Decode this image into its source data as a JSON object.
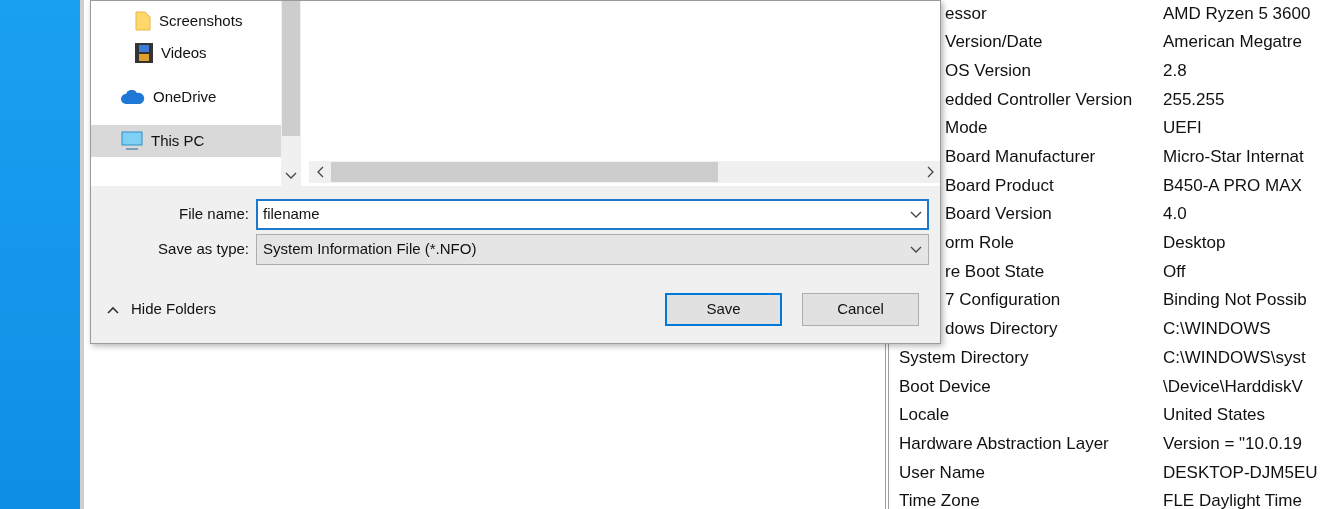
{
  "dialog": {
    "nav_items": [
      {
        "label": "Screenshots",
        "kind": "folder",
        "selected": false
      },
      {
        "label": "Videos",
        "kind": "videos",
        "selected": false
      },
      {
        "label": "OneDrive",
        "kind": "cloud",
        "selected": false
      },
      {
        "label": "This PC",
        "kind": "pc",
        "selected": true
      }
    ],
    "file_name": {
      "label": "File name:",
      "value": "filename"
    },
    "save_as_type": {
      "label": "Save as type:",
      "value": "System Information File (*.NFO)"
    },
    "hide_folders": "Hide Folders",
    "buttons": [
      {
        "label": "Save",
        "default": true
      },
      {
        "label": "Cancel",
        "default": false
      }
    ]
  },
  "summary": [
    {
      "item": "essor",
      "value": "AMD Ryzen 5 3600"
    },
    {
      "item": "Version/Date",
      "value": "American Megatre"
    },
    {
      "item": "OS Version",
      "value": "2.8"
    },
    {
      "item": "edded Controller Version",
      "value": "255.255"
    },
    {
      "item": "Mode",
      "value": "UEFI"
    },
    {
      "item": "Board Manufacturer",
      "value": "Micro-Star Internat"
    },
    {
      "item": "Board Product",
      "value": "B450-A PRO MAX"
    },
    {
      "item": "Board Version",
      "value": "4.0"
    },
    {
      "item": "orm Role",
      "value": "Desktop"
    },
    {
      "item": "re Boot State",
      "value": "Off"
    },
    {
      "item": "7 Configuration",
      "value": "Binding Not Possib"
    },
    {
      "item": "dows Directory",
      "value": "C:\\WINDOWS"
    },
    {
      "item": "System Directory",
      "value": "C:\\WINDOWS\\syst"
    },
    {
      "item": "Boot Device",
      "value": "\\Device\\HarddiskV"
    },
    {
      "item": "Locale",
      "value": "United States"
    },
    {
      "item": "Hardware Abstraction Layer",
      "value": "Version = \"10.0.19"
    },
    {
      "item": "User Name",
      "value": "DESKTOP-DJM5EU"
    },
    {
      "item": "Time Zone",
      "value": "FLE Daylight Time"
    }
  ]
}
